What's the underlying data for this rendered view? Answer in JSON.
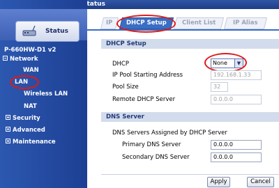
{
  "window": {
    "title": "Status"
  },
  "sidebar": {
    "status_button": "Status",
    "model": "P-660HW-D1 v2",
    "network": {
      "label": "Network",
      "items": [
        "WAN",
        "LAN",
        "Wireless LAN",
        "NAT"
      ]
    },
    "sections": [
      "Security",
      "Advanced",
      "Maintenance"
    ]
  },
  "tabs": [
    "IP",
    "DHCP Setup",
    "Client List",
    "IP Alias"
  ],
  "dhcp_setup": {
    "heading": "DHCP Setup",
    "dhcp_label": "DHCP",
    "dhcp_value": "None",
    "pool_start_label": "IP Pool Starting Address",
    "pool_start_value": "192.168.1.33",
    "pool_size_label": "Pool Size",
    "pool_size_value": "32",
    "remote_label": "Remote DHCP Server",
    "remote_value": "0.0.0.0"
  },
  "dns_server": {
    "heading": "DNS Server",
    "assigned_label": "DNS Servers Assigned by DHCP Server",
    "primary_label": "Primary DNS Server",
    "primary_value": "0.0.0.0",
    "secondary_label": "Secondary DNS Server",
    "secondary_value": "0.0.0.0"
  },
  "buttons": {
    "apply": "Apply",
    "cancel": "Cancel"
  },
  "colors": {
    "nav_blue": "#1c3f93",
    "active_tab": "#3a6ec4",
    "section_bar": "#d3dcec",
    "highlight_red": "#e01919"
  }
}
